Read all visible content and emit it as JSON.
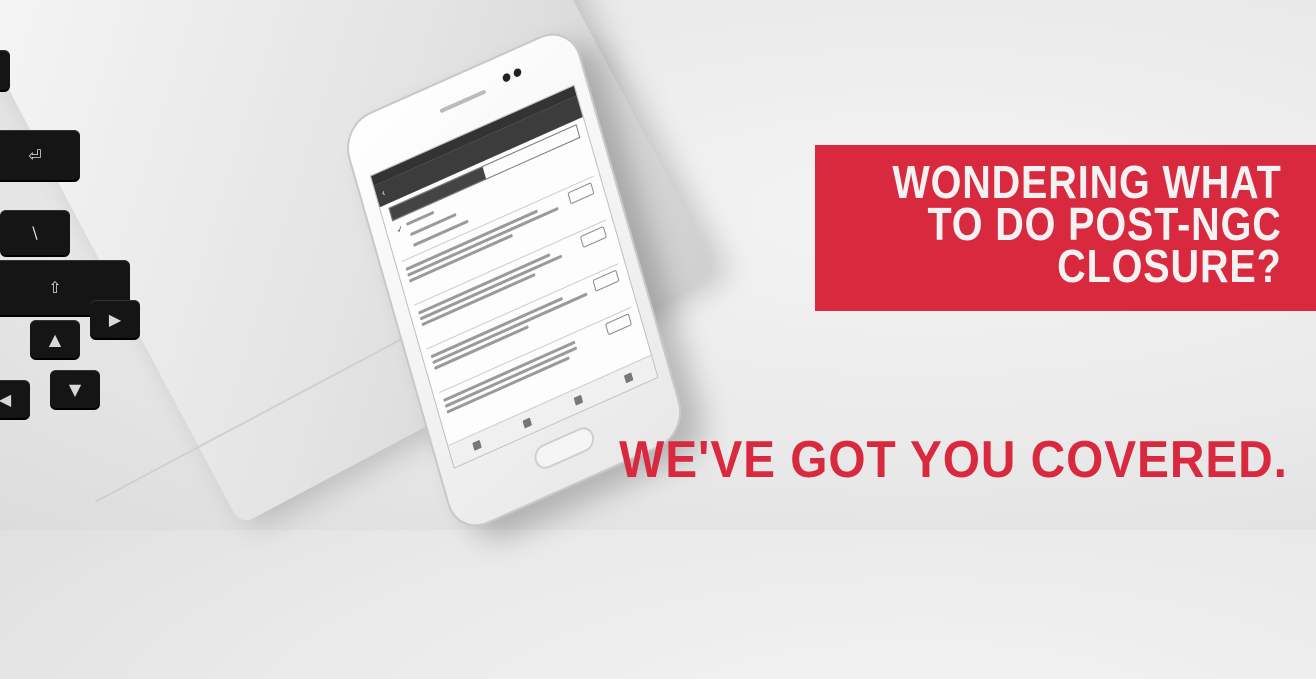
{
  "headline": "WONDERING WHAT\nTO DO POST-NGC\nCLOSURE?",
  "tagline": "WE'VE GOT YOU COVERED.",
  "colors": {
    "accent_red": "#d8293f",
    "headline_text": "#f2f2f2",
    "background": "#ececec"
  },
  "phone": {
    "icon": "smartphone-icon"
  },
  "laptop": {
    "icon": "laptop-keyboard-icon"
  }
}
